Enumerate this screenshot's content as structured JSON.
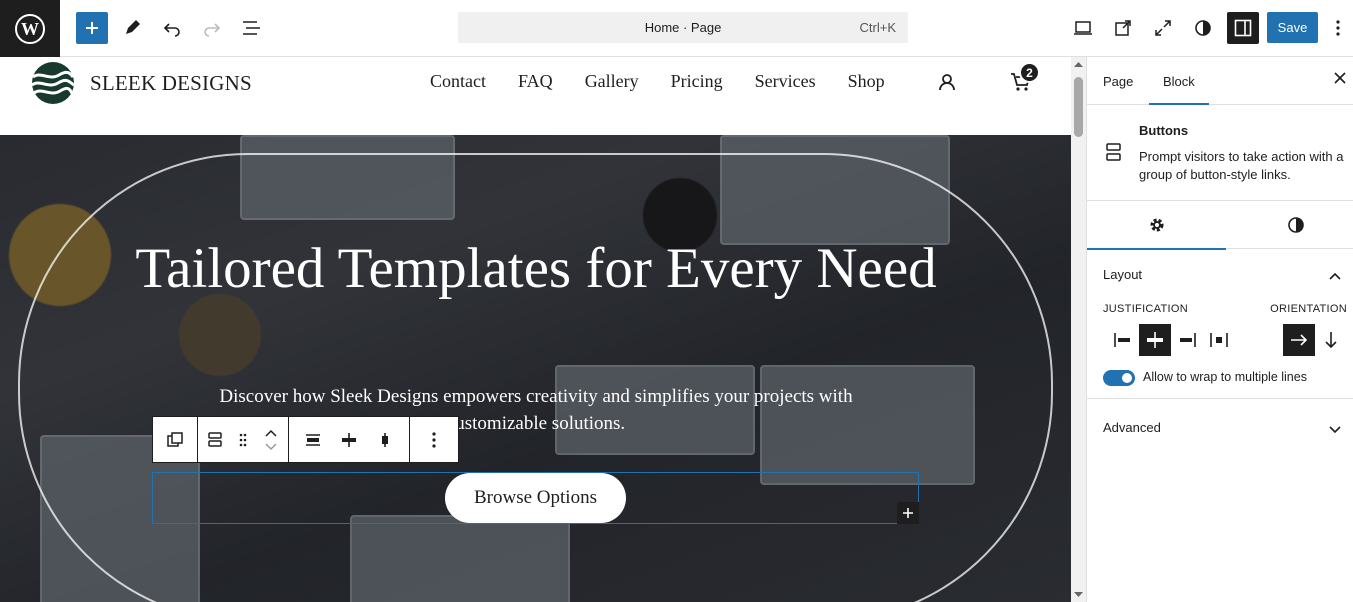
{
  "toolbar": {
    "command_title": "Home · Page",
    "command_shortcut": "Ctrl+K",
    "save_label": "Save"
  },
  "site": {
    "title": "SLEEK DESIGNS",
    "nav": [
      "Contact",
      "FAQ",
      "Gallery",
      "Pricing",
      "Services",
      "Shop"
    ],
    "cart_count": "2"
  },
  "hero": {
    "title": "Tailored Templates for Every Need",
    "subtitle": "Discover how Sleek Designs empowers creativity and simplifies your projects with customizable solutions.",
    "button": "Browse Options"
  },
  "sidebar": {
    "tabs": [
      "Page",
      "Block"
    ],
    "block_title": "Buttons",
    "block_description": "Prompt visitors to take action with a group of button-style links.",
    "layout_label": "Layout",
    "justification_label": "JUSTIFICATION",
    "orientation_label": "ORIENTATION",
    "wrap_label": "Allow to wrap to multiple lines",
    "wrap_enabled": true,
    "advanced_label": "Advanced"
  },
  "colors": {
    "accent": "#2271b1",
    "dark": "#1e1e1e"
  }
}
